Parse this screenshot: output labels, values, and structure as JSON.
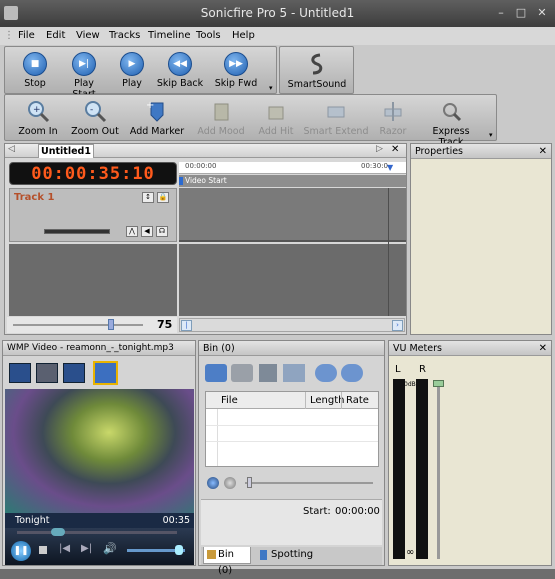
{
  "window": {
    "title": "Sonicfire Pro 5 - Untitled1",
    "min": "–",
    "max": "□",
    "close": "✕"
  },
  "menu": {
    "items": [
      "File",
      "Edit",
      "View",
      "Tracks",
      "Timeline",
      "Tools",
      "Help"
    ]
  },
  "transport": {
    "stop": "Stop",
    "play_start": "Play Start",
    "play": "Play",
    "skip_back": "Skip Back",
    "skip_fwd": "Skip Fwd",
    "smartsound": "SmartSound"
  },
  "edit_toolbar": {
    "zoom_in": "Zoom In",
    "zoom_out": "Zoom Out",
    "add_marker": "Add Marker",
    "add_mood": "Add Mood",
    "add_hit": "Add Hit",
    "smart_extend": "Smart Extend",
    "razor": "Razor",
    "express_track": "Express Track"
  },
  "timeline": {
    "tab": "Untitled1",
    "timecode": "00:00:35:10",
    "ruler_start": "00:00:00",
    "ruler_end": "00:30:0",
    "video_start": "Video Start",
    "track_name": "Track 1",
    "zoom_value": "75",
    "zoom_fraction": 0.75
  },
  "properties": {
    "title": "Properties"
  },
  "wmp": {
    "title": "WMP Video - reamonn_-_tonight.mp3",
    "track_title": "Tonight",
    "time": "00:35"
  },
  "bin": {
    "title": "Bin (0)",
    "columns": [
      "File",
      "Length",
      "Rate"
    ],
    "start_label": "Start:",
    "start_value": "00:00:00",
    "tab_bin": "Bin (0)",
    "tab_spotting": "Spotting"
  },
  "vu": {
    "title": "VU Meters",
    "left": "L",
    "right": "R",
    "db": "0dB",
    "inf": "∞"
  },
  "colors": {
    "timecode": "#ff5a1c",
    "track_name": "#b5502a",
    "accent_blue": "#1f5fb0"
  }
}
